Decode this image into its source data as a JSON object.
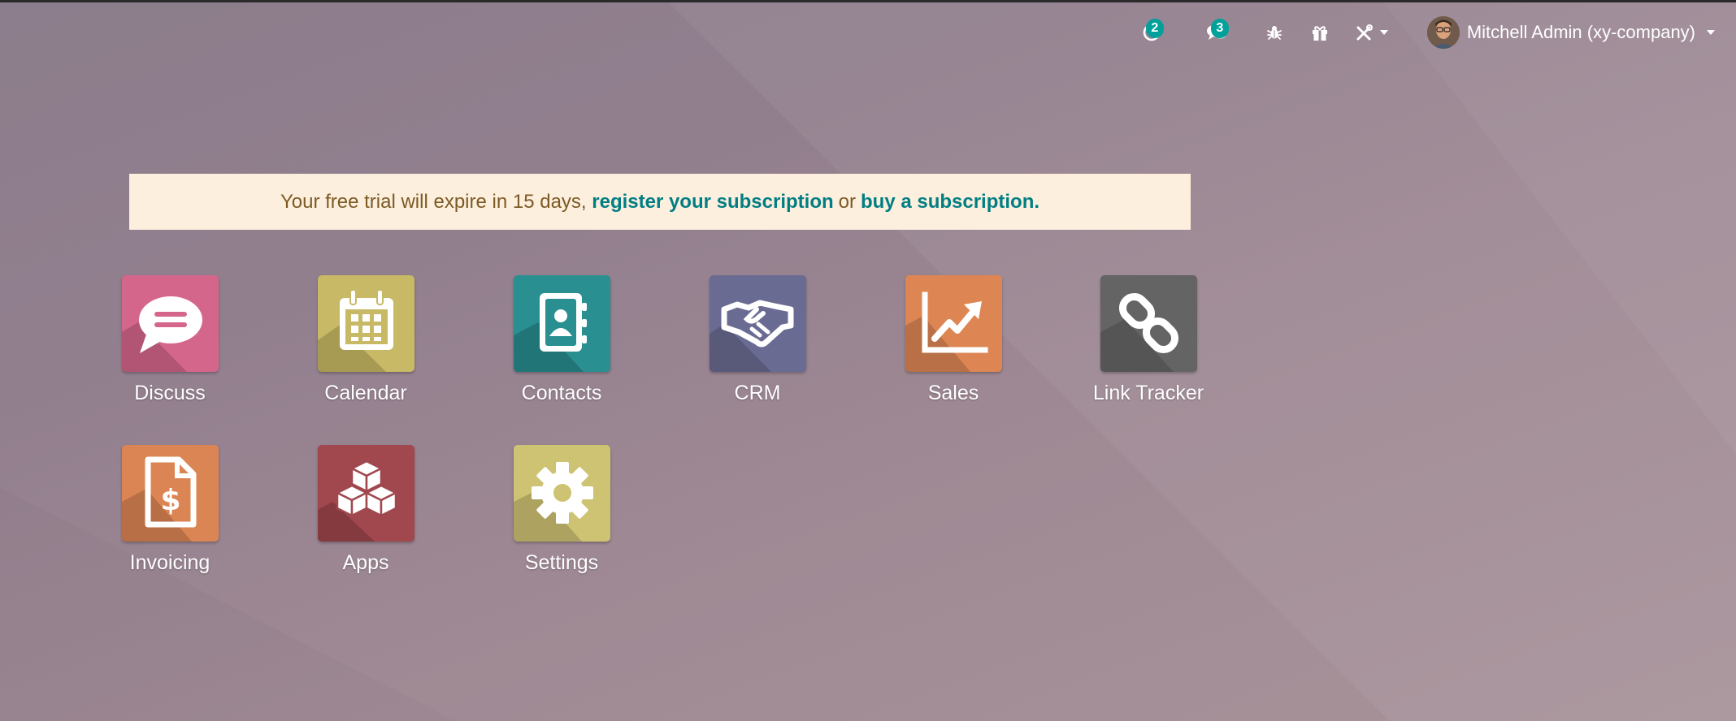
{
  "systray": {
    "activity_count": "2",
    "messages_count": "3",
    "user_name": "Mitchell Admin (xy-company)",
    "icons": [
      "clock-icon",
      "chat-icon",
      "bug-icon",
      "gift-icon",
      "tools-icon"
    ]
  },
  "banner": {
    "text": "Your free trial will expire in 15 days, ",
    "register_link": "register your subscription",
    "or_text": "or",
    "buy_link": "buy a subscription."
  },
  "apps": [
    {
      "label": "Discuss",
      "icon": "chat-bubble-icon",
      "color": "#d5668b"
    },
    {
      "label": "Calendar",
      "icon": "calendar-icon",
      "color": "#c7b965"
    },
    {
      "label": "Contacts",
      "icon": "address-book-icon",
      "color": "#2a8f91"
    },
    {
      "label": "CRM",
      "icon": "handshake-icon",
      "color": "#6a6b92"
    },
    {
      "label": "Sales",
      "icon": "chart-up-icon",
      "color": "#dd8654"
    },
    {
      "label": "Link Tracker",
      "icon": "link-icon",
      "color": "#646464"
    },
    {
      "label": "Invoicing",
      "icon": "invoice-icon",
      "color": "#dc8554"
    },
    {
      "label": "Apps",
      "icon": "cubes-icon",
      "color": "#a1474e"
    },
    {
      "label": "Settings",
      "icon": "gear-icon",
      "color": "#cec273"
    }
  ]
}
